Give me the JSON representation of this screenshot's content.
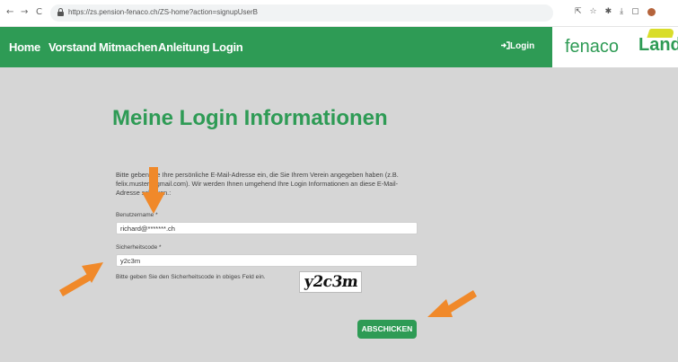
{
  "browser": {
    "back": "←",
    "forward": "→",
    "reload": "C",
    "url": "https://zs.pension-fenaco.ch/ZS-home?action=signupUserB",
    "toolbar_icons": [
      "⇱",
      "☆",
      "✱",
      "⤓",
      "▢"
    ]
  },
  "nav": {
    "items": [
      "Home",
      "Vorstand",
      "Mitmachen",
      "Anleitung Login"
    ],
    "login": "Login",
    "login_icon": "sign-in-icon"
  },
  "logos": {
    "fenaco": "fenaco",
    "landi": "Landi"
  },
  "form": {
    "title": "Meine Login Informationen",
    "intro": "Bitte geben Sie Ihre persönliche E-Mail-Adresse ein, die Sie Ihrem Verein angegeben haben (z.B. felix.muster@gmail.com). Wir werden Ihnen umgehend Ihre Login Informationen an diese E-Mail-Adresse schicken.:",
    "username_label": "Benutzername *",
    "username_value": "richard@*******.ch",
    "security_label": "Sicherheitscode *",
    "security_value": "y2c3m",
    "hint": "Bitte geben Sie den Sicherheitscode in obiges Feld ein.",
    "captcha": "y2c3m",
    "submit": "ABSCHICKEN"
  },
  "colors": {
    "brand_green": "#2e9b55",
    "arrow_orange": "#f0892a",
    "content_bg": "#d6d6d6"
  }
}
